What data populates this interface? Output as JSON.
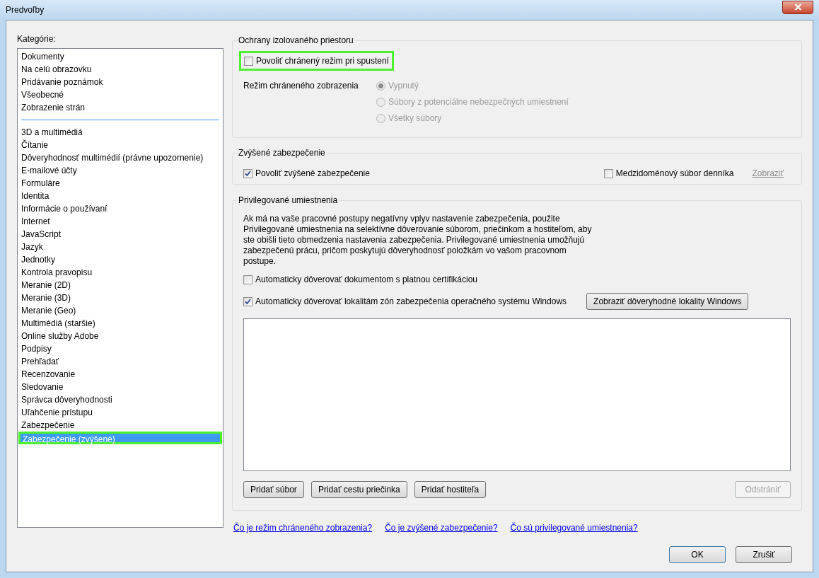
{
  "window": {
    "title": "Predvoľby"
  },
  "sidebar": {
    "label": "Kategórie:",
    "groups": [
      [
        {
          "label": "Dokumenty",
          "selected": false,
          "highlighted": false
        },
        {
          "label": "Na celú obrazovku",
          "selected": false,
          "highlighted": false
        },
        {
          "label": "Pridávanie poznámok",
          "selected": false,
          "highlighted": false
        },
        {
          "label": "Všeobecné",
          "selected": false,
          "highlighted": false
        },
        {
          "label": "Zobrazenie strán",
          "selected": false,
          "highlighted": false
        }
      ],
      [
        {
          "label": "3D a multimédiá",
          "selected": false,
          "highlighted": false
        },
        {
          "label": "Čítanie",
          "selected": false,
          "highlighted": false
        },
        {
          "label": "Dôveryhodnosť multimédií (právne upozornenie)",
          "selected": false,
          "highlighted": false
        },
        {
          "label": "E-mailové účty",
          "selected": false,
          "highlighted": false
        },
        {
          "label": "Formuláre",
          "selected": false,
          "highlighted": false
        },
        {
          "label": "Identita",
          "selected": false,
          "highlighted": false
        },
        {
          "label": "Informácie o používaní",
          "selected": false,
          "highlighted": false
        },
        {
          "label": "Internet",
          "selected": false,
          "highlighted": false
        },
        {
          "label": "JavaScript",
          "selected": false,
          "highlighted": false
        },
        {
          "label": "Jazyk",
          "selected": false,
          "highlighted": false
        },
        {
          "label": "Jednotky",
          "selected": false,
          "highlighted": false
        },
        {
          "label": "Kontrola pravopisu",
          "selected": false,
          "highlighted": false
        },
        {
          "label": "Meranie (2D)",
          "selected": false,
          "highlighted": false
        },
        {
          "label": "Meranie (3D)",
          "selected": false,
          "highlighted": false
        },
        {
          "label": "Meranie (Geo)",
          "selected": false,
          "highlighted": false
        },
        {
          "label": "Multimédiá (staršie)",
          "selected": false,
          "highlighted": false
        },
        {
          "label": "Online služby Adobe",
          "selected": false,
          "highlighted": false
        },
        {
          "label": "Podpisy",
          "selected": false,
          "highlighted": false
        },
        {
          "label": "Prehľadať",
          "selected": false,
          "highlighted": false
        },
        {
          "label": "Recenzovanie",
          "selected": false,
          "highlighted": false
        },
        {
          "label": "Sledovanie",
          "selected": false,
          "highlighted": false
        },
        {
          "label": "Správca dôveryhodnosti",
          "selected": false,
          "highlighted": false
        },
        {
          "label": "Uľahčenie prístupu",
          "selected": false,
          "highlighted": false
        },
        {
          "label": "Zabezpečenie",
          "selected": false,
          "highlighted": false
        },
        {
          "label": "Zabezpečenie (zvýšené)",
          "selected": true,
          "highlighted": true
        }
      ]
    ]
  },
  "sandbox": {
    "title": "Ochrany izolovaného priestoru",
    "startup_checkbox": {
      "label": "Povoliť chránený režim pri spustení",
      "checked": false,
      "highlighted": true
    },
    "view_mode_label": "Režim chráneného zobrazenia",
    "radios": [
      {
        "label": "Vypnutý",
        "selected": true,
        "disabled": true
      },
      {
        "label": "Súbory z potenciálne nebezpečných umiestnení",
        "selected": false,
        "disabled": true
      },
      {
        "label": "Všetky súbory",
        "selected": false,
        "disabled": true
      }
    ]
  },
  "enhanced": {
    "title": "Zvýšené zabezpečenie",
    "enable_checkbox": {
      "label": "Povoliť zvýšené zabezpečenie",
      "checked": true
    },
    "log_checkbox": {
      "label": "Medzidoménový súbor denníka",
      "checked": false
    },
    "view_link": {
      "label": "Zobraziť",
      "disabled": true
    }
  },
  "privileged": {
    "title": "Privilegované umiestnenia",
    "description": "Ak má na vaše pracovné postupy negatívny vplyv nastavenie zabezpečenia, použite Privilegované umiestnenia na selektívne dôverovanie súborom, priečinkom a hostiteľom, aby ste obišli tieto obmedzenia nastavenia zabezpečenia. Privilegované umiestnenia umožňujú zabezpečenú prácu, pričom poskytujú dôveryhodnosť položkám vo vašom pracovnom postupe.",
    "cert_checkbox": {
      "label": "Automaticky dôverovať dokumentom s platnou certifikáciou",
      "checked": false
    },
    "zones_checkbox": {
      "label": "Automaticky dôverovať lokalitám zón zabezpečenia operačného systému Windows",
      "checked": true
    },
    "zones_button": "Zobraziť dôveryhodné lokality Windows",
    "buttons": [
      {
        "label": "Pridať súbor",
        "disabled": false
      },
      {
        "label": "Pridať cestu priečinka",
        "disabled": false
      },
      {
        "label": "Pridať hostiteľa",
        "disabled": false
      }
    ],
    "remove_button": {
      "label": "Odstrániť",
      "disabled": true
    }
  },
  "links": [
    "Čo je režim chráneného zobrazenia?",
    "Čo je zvýšené zabezpečenie?",
    "Čo sú privilegované umiestnenia?"
  ],
  "footer_buttons": [
    {
      "label": "OK",
      "default": true
    },
    {
      "label": "Zrušiť",
      "default": false
    }
  ]
}
